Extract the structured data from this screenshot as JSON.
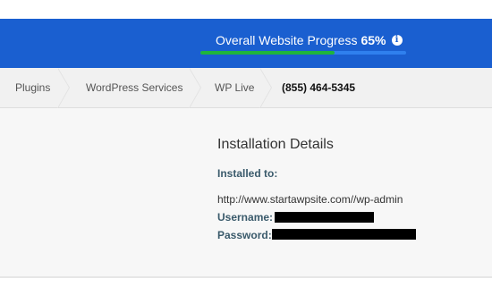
{
  "header": {
    "progress_label": "Overall Website Progress",
    "progress_percent_text": "65%",
    "progress_value": 0.65,
    "info_icon": "i",
    "colors": {
      "background": "#1a5fd0",
      "fill": "#1fb53c",
      "track": "#2f80ee"
    }
  },
  "breadcrumb": {
    "items": [
      {
        "label": "Plugins"
      },
      {
        "label": "WordPress Services"
      },
      {
        "label": "WP Live"
      }
    ],
    "phone": "(855) 464-5345"
  },
  "installation": {
    "title": "Installation Details",
    "installed_to_label": "Installed to:",
    "url": "http://www.startawpsite.com//wp-admin",
    "username_label": "Username:",
    "password_label": "Password:"
  }
}
